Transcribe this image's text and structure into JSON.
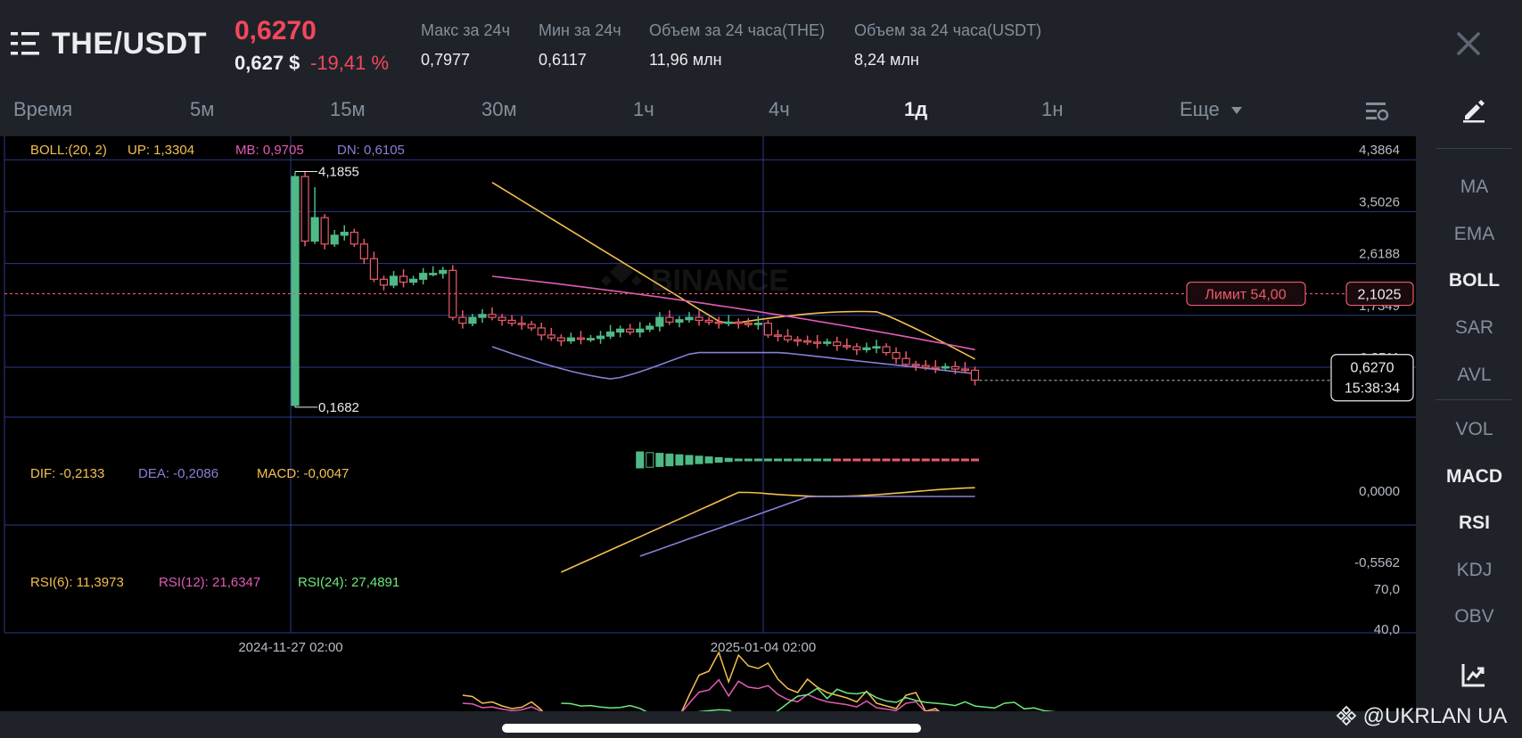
{
  "header": {
    "pair": "THE/USDT",
    "price": "0,6270",
    "price_usd": "0,627 $",
    "change": "-19,41 %",
    "stats": [
      {
        "label": "Макс за 24ч",
        "value": "0,7977"
      },
      {
        "label": "Мин за 24ч",
        "value": "0,6117"
      },
      {
        "label": "Объем за 24 часа(THE)",
        "value": "11,96 млн"
      },
      {
        "label": "Объем за 24 часа(USDT)",
        "value": "8,24 млн"
      }
    ],
    "icons": {
      "menu": "menu-icon",
      "close": "close-icon"
    }
  },
  "tabs": {
    "items": [
      {
        "label": "Время",
        "active": false
      },
      {
        "label": "5м",
        "active": false
      },
      {
        "label": "15м",
        "active": false
      },
      {
        "label": "30м",
        "active": false
      },
      {
        "label": "1ч",
        "active": false
      },
      {
        "label": "4ч",
        "active": false
      },
      {
        "label": "1д",
        "active": true
      },
      {
        "label": "1н",
        "active": false
      },
      {
        "label": "Еще",
        "active": false
      }
    ],
    "settings_icon": "chart-settings-icon"
  },
  "sidebar": {
    "draw_icon": "pen-icon",
    "items": [
      {
        "label": "MA",
        "active": false
      },
      {
        "label": "EMA",
        "active": false
      },
      {
        "label": "BOLL",
        "active": true
      },
      {
        "label": "SAR",
        "active": false
      },
      {
        "label": "AVL",
        "active": false
      },
      {
        "label": "VOL",
        "active": false
      },
      {
        "label": "MACD",
        "active": true
      },
      {
        "label": "RSI",
        "active": true
      },
      {
        "label": "KDJ",
        "active": false
      },
      {
        "label": "OBV",
        "active": false
      }
    ],
    "bottom_icon": "indicator-chart-icon"
  },
  "chart_data": {
    "type": "candlestick",
    "watermark": "BINANCE",
    "boll": {
      "params": "BOLL:(20, 2)",
      "up": "UP: 1,3304",
      "mb": "MB: 0,9705",
      "dn": "DN: 0,6105"
    },
    "price_axis": [
      "4,3864",
      "3,5026",
      "2,6188",
      "1,7349",
      "0,8511"
    ],
    "ylim": [
      0,
      4.8
    ],
    "high_label": "4,1855",
    "low_label": "0,1682",
    "limit": {
      "label": "Лимит  54,00",
      "price": "2,1025",
      "value": 2.1025
    },
    "last": {
      "price": "0,6270",
      "countdown": "15:38:34",
      "value": 0.627
    },
    "x_labels": [
      "2024-11-27 02:00",
      "2025-01-04 02:00"
    ],
    "colors": {
      "up": "#4fba86",
      "down": "#ea5b6b",
      "boll_up": "#f4c04e",
      "boll_mb": "#e15bb5",
      "boll_dn": "#8a7fd6"
    },
    "macd": {
      "dif": "DIF: -0,2133",
      "dea": "DEA: -0,2086",
      "macd": "MACD: -0,0047",
      "axis": [
        "0,0000",
        "-0,5562"
      ]
    },
    "rsi": {
      "rsi6": "RSI(6): 11,3973",
      "rsi12": "RSI(12): 21,6347",
      "rsi24": "RSI(24): 27,4891",
      "axis": [
        "70,0",
        "40,0"
      ]
    }
  },
  "footer": {
    "brand": "@UKRLAN UA"
  }
}
